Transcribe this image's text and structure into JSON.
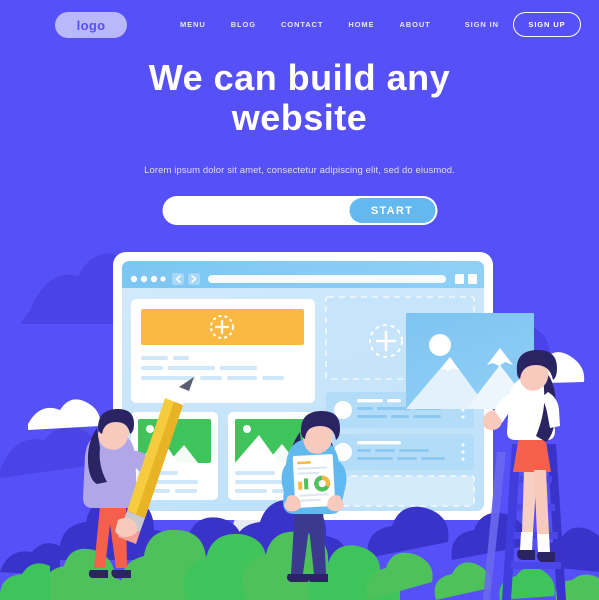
{
  "page": {
    "background_color": "#5650f8",
    "accent_blue": "#63b8f0",
    "accent_yellow": "#f9b942",
    "accent_green": "#3fc45c",
    "accent_coral": "#f4604c"
  },
  "header": {
    "logo": "logo",
    "nav": [
      {
        "label": "MENU"
      },
      {
        "label": "BLOG"
      },
      {
        "label": "CONTACT"
      },
      {
        "label": "HOME"
      },
      {
        "label": "ABOUT"
      }
    ],
    "sign_in": "SIGN IN",
    "sign_up": "SIGN UP"
  },
  "hero": {
    "headline_line1": "We can build any",
    "headline_line2": "website",
    "subheadline": "Lorem ipsum dolor sit amet, consectetur adipiscing elit, sed do eiusmod.",
    "search_placeholder": "",
    "search_value": "",
    "start_button": "START"
  },
  "illustration": {
    "browser_mockup": {
      "dots": 4,
      "back_icon": "chevron-left-icon",
      "forward_icon": "chevron-right-icon",
      "address_bar": "",
      "window_controls": 2
    },
    "add_media_icon": "plus-in-dashed-circle-icon",
    "characters": [
      {
        "name": "designer-with-pencil",
        "hair": "#2b2463",
        "top": "#b0a6e8",
        "pants": "#f4604c"
      },
      {
        "name": "analyst-with-report",
        "hair": "#2b2463",
        "top": "#61b9ef",
        "pants": "#3b3a8f"
      },
      {
        "name": "uploader-on-ladder",
        "hair": "#2b2463",
        "top": "#ffffff",
        "skirt": "#f4604c"
      }
    ],
    "foliage_color": "#4ec15a",
    "bush_shadow_color": "#3a33c9"
  }
}
